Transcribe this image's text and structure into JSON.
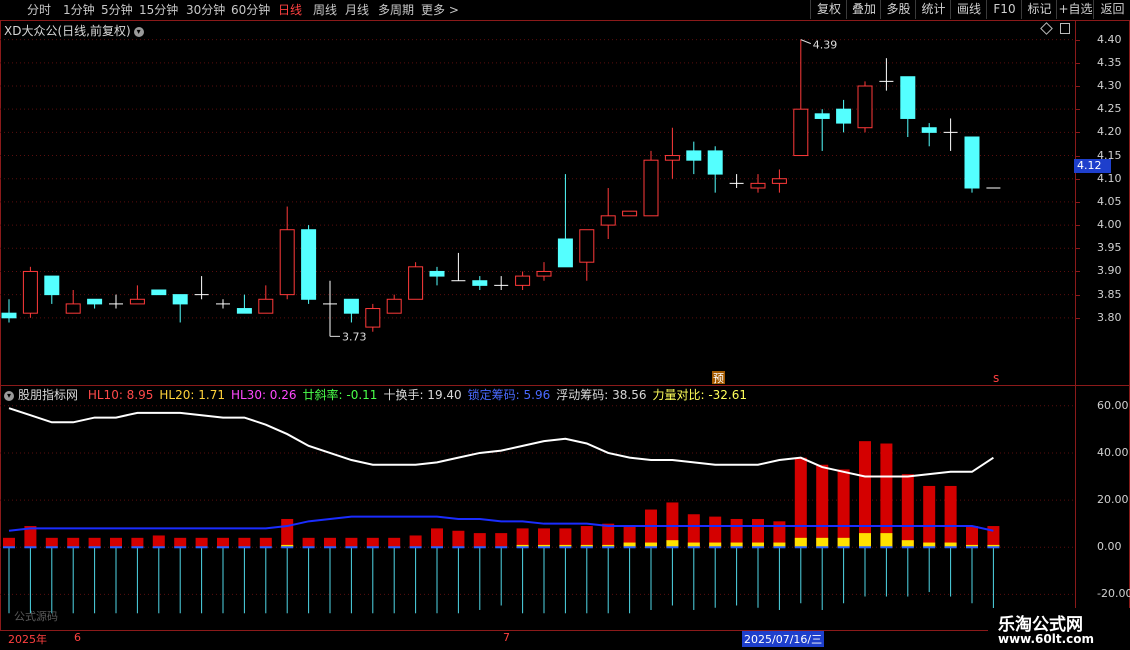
{
  "toolbar": {
    "periods": [
      "分时",
      "1分钟",
      "5分钟",
      "15分钟",
      "30分钟",
      "60分钟",
      "日线",
      "周线",
      "月线",
      "多周期",
      "更多 >"
    ],
    "active_period": "日线",
    "buttons": [
      "复权",
      "叠加",
      "多股",
      "统计",
      "画线",
      "F10",
      "标记",
      "+自选",
      "返回"
    ]
  },
  "main_chart": {
    "title": "XD大众公(日线,前复权)",
    "price_axis": [
      "4.40",
      "4.35",
      "4.30",
      "4.25",
      "4.20",
      "4.15",
      "4.10",
      "4.05",
      "4.00",
      "3.95",
      "3.90",
      "3.85",
      "3.80"
    ],
    "current_price": "4.12",
    "high_label": "4.39",
    "low_label": "3.73",
    "marker_yu": "预",
    "marker_s": "s",
    "up_color": "#ff3a3a",
    "down_color": "#54ffff"
  },
  "chart_data": {
    "type": "candlestick",
    "ylim": [
      3.75,
      4.41
    ],
    "candles": [
      {
        "o": 3.81,
        "h": 3.84,
        "l": 3.79,
        "c": 3.8
      },
      {
        "o": 3.81,
        "h": 3.91,
        "l": 3.8,
        "c": 3.9
      },
      {
        "o": 3.89,
        "h": 3.89,
        "l": 3.83,
        "c": 3.85
      },
      {
        "o": 3.81,
        "h": 3.86,
        "l": 3.81,
        "c": 3.83
      },
      {
        "o": 3.84,
        "h": 3.84,
        "l": 3.82,
        "c": 3.83
      },
      {
        "o": 3.83,
        "h": 3.85,
        "l": 3.82,
        "c": 3.83
      },
      {
        "o": 3.83,
        "h": 3.87,
        "l": 3.83,
        "c": 3.84
      },
      {
        "o": 3.86,
        "h": 3.86,
        "l": 3.85,
        "c": 3.85
      },
      {
        "o": 3.85,
        "h": 3.85,
        "l": 3.79,
        "c": 3.83
      },
      {
        "o": 3.85,
        "h": 3.89,
        "l": 3.84,
        "c": 3.85
      },
      {
        "o": 3.83,
        "h": 3.84,
        "l": 3.82,
        "c": 3.83
      },
      {
        "o": 3.82,
        "h": 3.85,
        "l": 3.81,
        "c": 3.81
      },
      {
        "o": 3.81,
        "h": 3.87,
        "l": 3.81,
        "c": 3.84
      },
      {
        "o": 3.85,
        "h": 4.04,
        "l": 3.84,
        "c": 3.99
      },
      {
        "o": 3.99,
        "h": 4.0,
        "l": 3.83,
        "c": 3.84
      },
      {
        "o": 3.83,
        "h": 3.88,
        "l": 3.76,
        "c": 3.83
      },
      {
        "o": 3.84,
        "h": 3.84,
        "l": 3.79,
        "c": 3.81
      },
      {
        "o": 3.78,
        "h": 3.83,
        "l": 3.77,
        "c": 3.82
      },
      {
        "o": 3.81,
        "h": 3.85,
        "l": 3.81,
        "c": 3.84
      },
      {
        "o": 3.84,
        "h": 3.92,
        "l": 3.84,
        "c": 3.91
      },
      {
        "o": 3.9,
        "h": 3.91,
        "l": 3.87,
        "c": 3.89
      },
      {
        "o": 3.88,
        "h": 3.94,
        "l": 3.88,
        "c": 3.88
      },
      {
        "o": 3.88,
        "h": 3.89,
        "l": 3.86,
        "c": 3.87
      },
      {
        "o": 3.87,
        "h": 3.89,
        "l": 3.86,
        "c": 3.87
      },
      {
        "o": 3.87,
        "h": 3.9,
        "l": 3.86,
        "c": 3.89
      },
      {
        "o": 3.89,
        "h": 3.92,
        "l": 3.88,
        "c": 3.9
      },
      {
        "o": 3.97,
        "h": 4.11,
        "l": 3.91,
        "c": 3.91
      },
      {
        "o": 3.92,
        "h": 3.96,
        "l": 3.88,
        "c": 3.99
      },
      {
        "o": 4.0,
        "h": 4.08,
        "l": 3.97,
        "c": 4.02
      },
      {
        "o": 4.02,
        "h": 4.03,
        "l": 4.02,
        "c": 4.03
      },
      {
        "o": 4.02,
        "h": 4.16,
        "l": 4.02,
        "c": 4.14
      },
      {
        "o": 4.14,
        "h": 4.21,
        "l": 4.1,
        "c": 4.15
      },
      {
        "o": 4.16,
        "h": 4.18,
        "l": 4.11,
        "c": 4.14
      },
      {
        "o": 4.16,
        "h": 4.17,
        "l": 4.07,
        "c": 4.11
      },
      {
        "o": 4.09,
        "h": 4.11,
        "l": 4.08,
        "c": 4.09
      },
      {
        "o": 4.08,
        "h": 4.11,
        "l": 4.07,
        "c": 4.09
      },
      {
        "o": 4.09,
        "h": 4.12,
        "l": 4.07,
        "c": 4.1
      },
      {
        "o": 4.15,
        "h": 4.4,
        "l": 4.15,
        "c": 4.25
      },
      {
        "o": 4.24,
        "h": 4.25,
        "l": 4.16,
        "c": 4.23
      },
      {
        "o": 4.25,
        "h": 4.27,
        "l": 4.2,
        "c": 4.22
      },
      {
        "o": 4.21,
        "h": 4.31,
        "l": 4.2,
        "c": 4.3
      },
      {
        "o": 4.31,
        "h": 4.36,
        "l": 4.29,
        "c": 4.31
      },
      {
        "o": 4.32,
        "h": 4.32,
        "l": 4.19,
        "c": 4.23
      },
      {
        "o": 4.21,
        "h": 4.22,
        "l": 4.17,
        "c": 4.2
      },
      {
        "o": 4.2,
        "h": 4.23,
        "l": 4.16,
        "c": 4.2
      },
      {
        "o": 4.19,
        "h": 4.19,
        "l": 4.07,
        "c": 4.08
      },
      {
        "o": 4.08,
        "h": 4.08,
        "l": 4.08,
        "c": 4.08
      }
    ],
    "indicator": {
      "ylim": [
        -30,
        65
      ],
      "ticks": [
        "60.00",
        "40.00",
        "20.00",
        "0.00",
        "-20.00"
      ],
      "white_line": [
        59,
        56,
        53,
        53,
        55,
        55,
        57,
        57,
        57,
        56,
        55,
        55,
        52,
        48,
        43,
        40,
        37,
        35,
        35,
        35,
        36,
        38,
        40,
        41,
        43,
        45,
        46,
        44,
        40,
        38,
        37,
        37,
        36,
        35,
        35,
        35,
        37,
        38,
        34,
        32,
        30,
        30,
        30,
        31,
        32,
        32,
        38
      ],
      "blue_line": [
        7,
        8,
        8,
        8,
        8,
        8,
        8,
        8,
        8,
        8,
        8,
        8,
        8,
        9,
        11,
        12,
        13,
        13,
        13,
        13,
        13,
        12,
        12,
        11,
        11,
        10,
        10,
        10,
        9,
        9,
        9,
        9,
        9,
        9,
        9,
        9,
        9,
        9,
        9,
        9,
        9,
        9,
        9,
        9,
        9,
        9,
        7
      ],
      "red_bars": [
        4,
        9,
        4,
        4,
        4,
        4,
        4,
        5,
        4,
        4,
        4,
        4,
        4,
        12,
        4,
        4,
        4,
        4,
        4,
        5,
        8,
        7,
        6,
        6,
        8,
        8,
        8,
        9,
        10,
        9,
        16,
        19,
        14,
        13,
        12,
        12,
        11,
        38,
        35,
        33,
        45,
        44,
        31,
        26,
        26,
        9,
        9
      ],
      "yellow_bars": [
        0,
        0,
        0,
        0,
        0,
        0,
        0,
        0,
        0,
        0,
        0,
        0,
        0,
        1,
        0,
        0,
        0,
        0,
        0,
        0,
        0,
        0,
        0,
        0,
        1,
        1,
        1,
        1,
        1,
        2,
        2,
        3,
        2,
        2,
        2,
        2,
        2,
        4,
        4,
        4,
        6,
        6,
        3,
        2,
        2,
        1,
        1
      ],
      "cyan_spikes": [
        -35,
        -32,
        -45,
        -42,
        -44,
        -45,
        -46,
        -48,
        -50,
        -50,
        -48,
        -45,
        -43,
        -41,
        -42,
        -44,
        -45,
        -43,
        -42,
        -38,
        -36,
        -32,
        -28,
        -26,
        -30,
        -35,
        -38,
        -35,
        -30,
        -30,
        -28,
        -26,
        -28,
        -27,
        -26,
        -27,
        -28,
        -25,
        -28,
        -25,
        -22,
        -22,
        -22,
        -20,
        -22,
        -25,
        -32
      ]
    }
  },
  "indicator_header": {
    "name": "股朋指标网",
    "items": [
      {
        "label": "HL10: 8.95",
        "color": "#ff4a4a"
      },
      {
        "label": "HL20: 1.71",
        "color": "#ffd23a"
      },
      {
        "label": "HL30: 0.26",
        "color": "#ff4aff"
      },
      {
        "label": "廿斜率: -0.11",
        "color": "#4aff4a"
      },
      {
        "label": "十换手: 19.40",
        "color": "#d8d8d8"
      },
      {
        "label": "锁定筹码: 5.96",
        "color": "#4a6aff"
      },
      {
        "label": "浮动筹码: 38.56",
        "color": "#d8d8d8"
      },
      {
        "label": "力量对比: -32.61",
        "color": "#ffff5a"
      }
    ]
  },
  "bottom": {
    "source_label": "公式源码",
    "year_label": "2025年",
    "month6": "6",
    "month7": "7",
    "date_label": "2025/07/16/三"
  },
  "watermark": {
    "line1": "乐淘公式网",
    "line2": "www.60lt.com"
  }
}
